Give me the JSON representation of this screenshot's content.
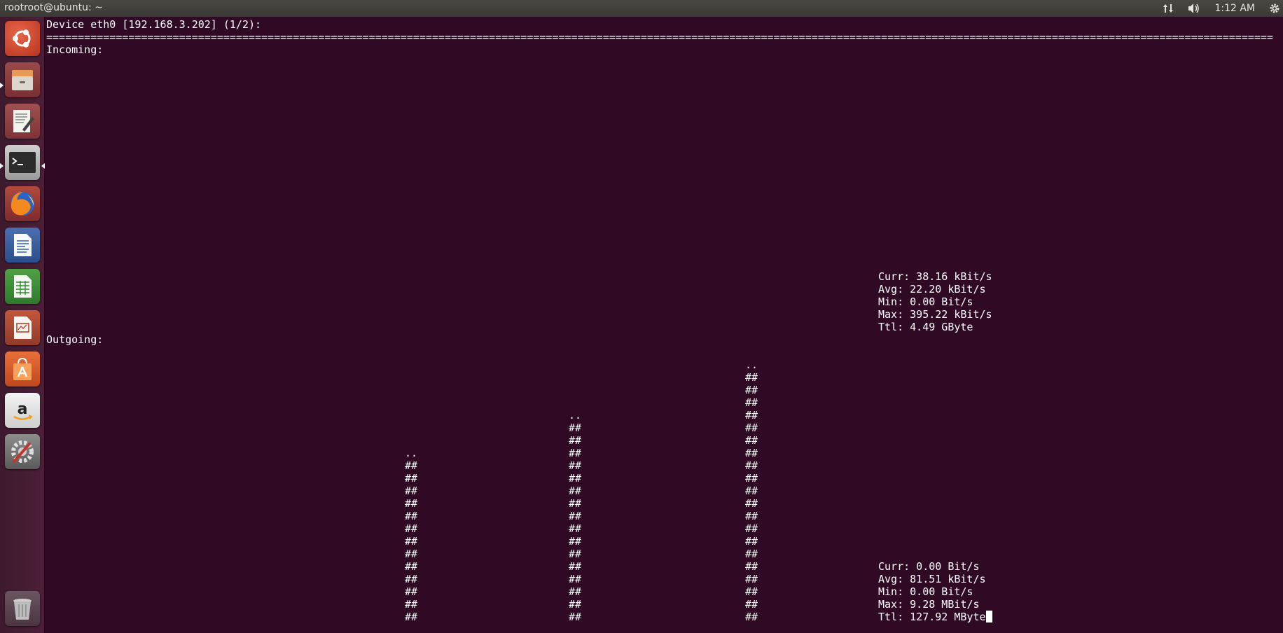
{
  "window": {
    "title": "rootroot@ubuntu: ~"
  },
  "panel": {
    "clock": "1:12 AM",
    "network_icon": "network-updown-icon",
    "sound_icon": "speaker-volume-icon",
    "settings_icon": "gear-icon"
  },
  "launcher": {
    "items": [
      {
        "name": "ubuntu-dash",
        "icon": "ubuntu-logo-icon"
      },
      {
        "name": "files",
        "icon": "file-cabinet-icon"
      },
      {
        "name": "text-editor",
        "icon": "text-editor-icon"
      },
      {
        "name": "terminal",
        "icon": "terminal-icon"
      },
      {
        "name": "firefox",
        "icon": "firefox-icon"
      },
      {
        "name": "libreoffice-writer",
        "icon": "writer-icon"
      },
      {
        "name": "libreoffice-calc",
        "icon": "calc-icon"
      },
      {
        "name": "libreoffice-impress",
        "icon": "impress-icon"
      },
      {
        "name": "software-center",
        "icon": "shopping-bag-icon"
      },
      {
        "name": "amazon",
        "icon": "amazon-icon"
      },
      {
        "name": "system-settings",
        "icon": "settings-wrench-icon"
      },
      {
        "name": "trash",
        "icon": "trash-icon"
      }
    ]
  },
  "terminal": {
    "header": "Device eth0 [192.168.3.202] (1/2):",
    "separator": "==================================================================================================================================================================================================",
    "incoming": {
      "label": "Incoming:",
      "stats": [
        "Curr: 38.16 kBit/s",
        "Avg: 22.20 kBit/s",
        "Min: 0.00 Bit/s",
        "Max: 395.22 kBit/s",
        "Ttl: 4.49 GByte"
      ]
    },
    "outgoing": {
      "label": "Outgoing:",
      "bar_top": "..",
      "bar_fill": "##",
      "bars": [
        {
          "full_rows": 13
        },
        {
          "full_rows": 16
        },
        {
          "full_rows": 20
        }
      ],
      "stats": [
        "Curr: 0.00 Bit/s",
        "Avg: 81.51 kBit/s",
        "Min: 0.00 Bit/s",
        "Max: 9.28 MBit/s",
        "Ttl: 127.92 MByte"
      ]
    }
  }
}
